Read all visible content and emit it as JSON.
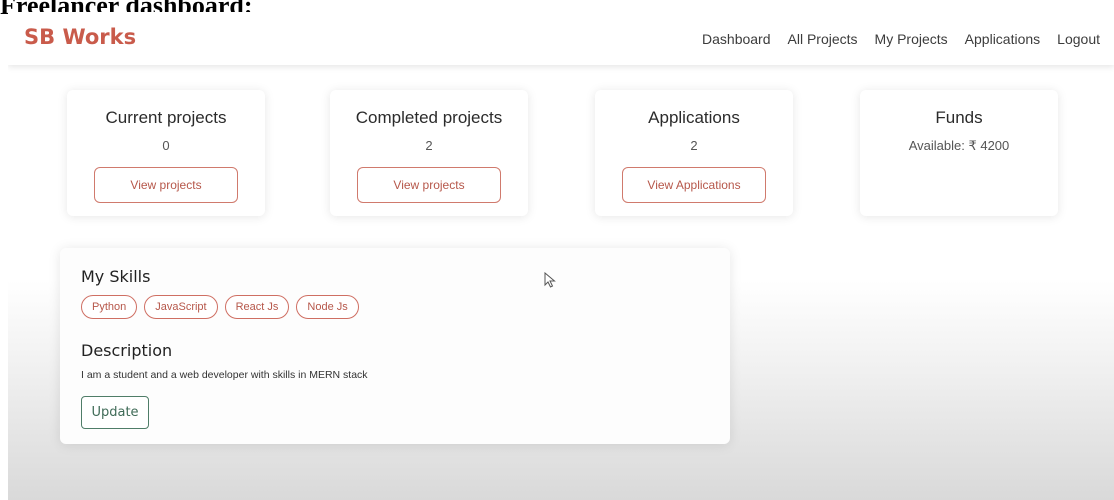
{
  "caption": "Freelancer dashboard:",
  "brand": "SB Works",
  "nav": [
    "Dashboard",
    "All Projects",
    "My Projects",
    "Applications",
    "Logout"
  ],
  "cards": [
    {
      "title": "Current projects",
      "value": "0",
      "button": "View projects"
    },
    {
      "title": "Completed projects",
      "value": "2",
      "button": "View projects"
    },
    {
      "title": "Applications",
      "value": "2",
      "button": "View Applications"
    },
    {
      "title": "Funds",
      "value": "Available: ₹ 4200",
      "button": ""
    }
  ],
  "profile": {
    "skills_title": "My Skills",
    "skills": [
      "Python",
      "JavaScript",
      "React Js",
      "Node Js"
    ],
    "description_title": "Description",
    "description": "I am a student and a web developer with skills in MERN stack",
    "update_label": "Update"
  },
  "colors": {
    "brand": "#c95b4b",
    "accent_border": "#d07a6d",
    "update_green": "#4f7d68"
  },
  "icons": {
    "pointer": "mouse-cursor-icon"
  }
}
